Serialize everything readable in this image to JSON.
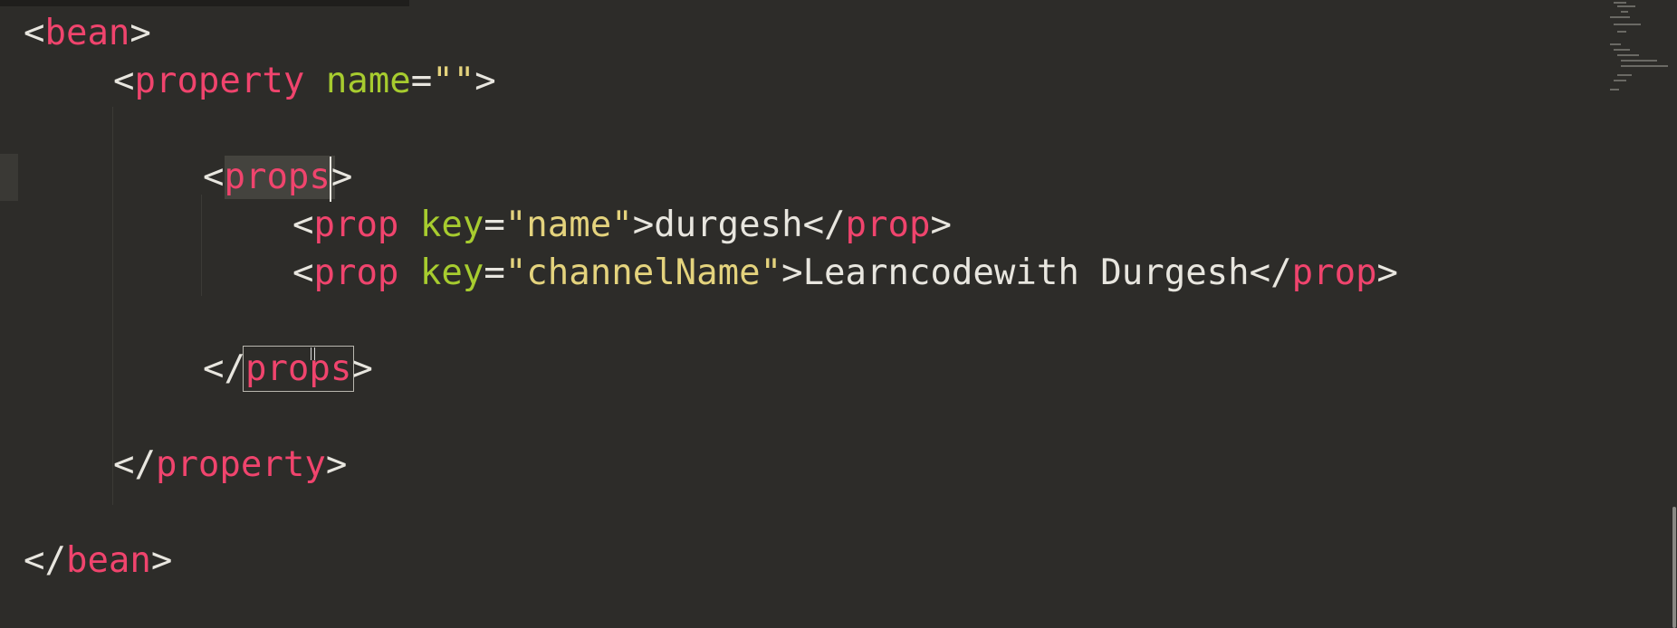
{
  "editor": {
    "lines": [
      {
        "punct_open": "<",
        "tag": "bean",
        "punct_close": ">"
      },
      {
        "punct_open": "<",
        "tag": "property",
        "attr_name": "name",
        "eq": "=",
        "attr_value": "\"\"",
        "punct_close": ">"
      },
      {
        "punct_open": "<",
        "tag": "props",
        "punct_close": ">"
      },
      {
        "punct_open": "<",
        "tag": "prop",
        "attr_name": "key",
        "eq": "=",
        "attr_value": "\"name\"",
        "punct_close": ">",
        "text": "durgesh",
        "end_open": "</",
        "end_tag": "prop",
        "end_close": ">"
      },
      {
        "punct_open": "<",
        "tag": "prop",
        "attr_name": "key",
        "eq": "=",
        "attr_value": "\"channelName\"",
        "punct_close": ">",
        "text": "Learncodewith Durgesh",
        "end_open": "</",
        "end_tag": "prop",
        "end_close": ">"
      },
      {
        "punct_open": "</",
        "tag": "props",
        "punct_close": ">"
      },
      {
        "punct_open": "</",
        "tag": "property",
        "punct_close": ">"
      },
      {
        "punct_open": "</",
        "tag": "bean",
        "punct_close": ">"
      }
    ]
  },
  "colors": {
    "background": "#2d2c29",
    "tag": "#f0446d",
    "attribute": "#a7cc2f",
    "string": "#e4d37d",
    "text": "#e8e6df"
  }
}
